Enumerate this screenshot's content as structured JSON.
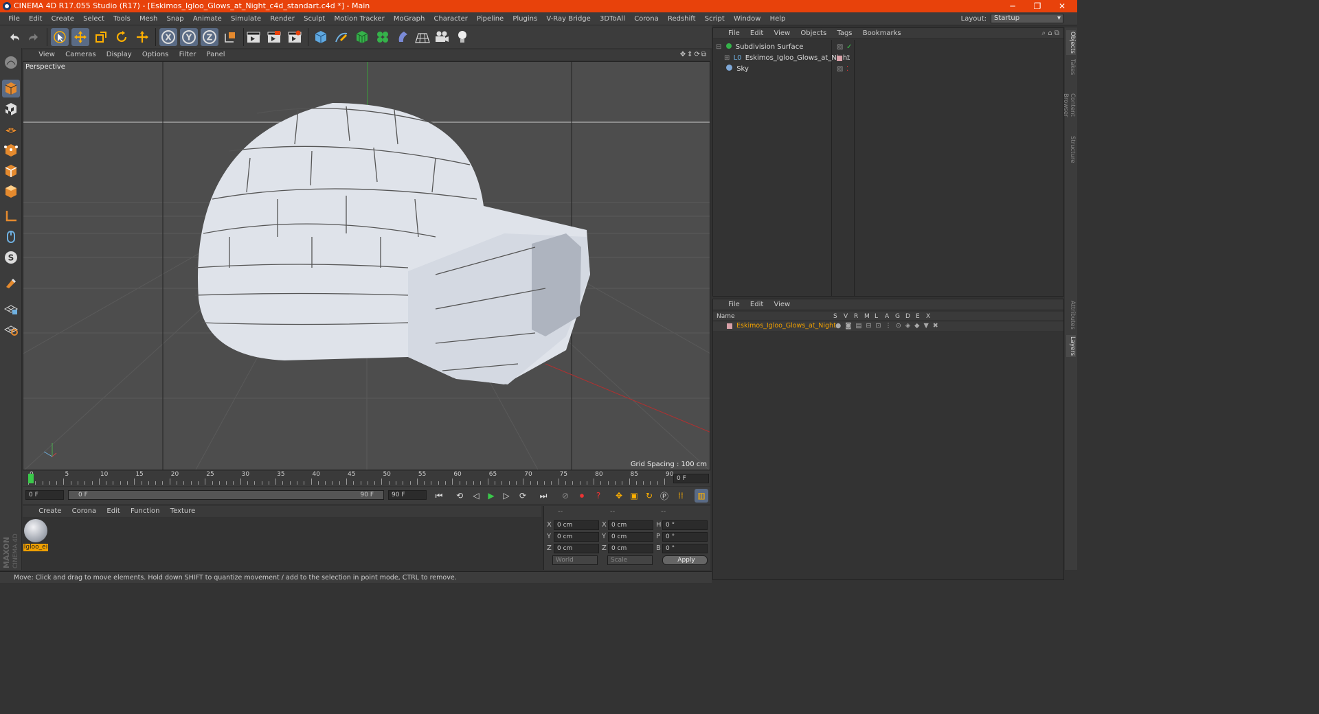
{
  "window": {
    "title": "CINEMA 4D R17.055 Studio (R17) - [Eskimos_Igloo_Glows_at_Night_c4d_standart.c4d *] - Main",
    "controls": [
      "─",
      "❐",
      "✕"
    ]
  },
  "menubar": {
    "items": [
      "File",
      "Edit",
      "Create",
      "Select",
      "Tools",
      "Mesh",
      "Snap",
      "Animate",
      "Simulate",
      "Render",
      "Sculpt",
      "Motion Tracker",
      "MoGraph",
      "Character",
      "Pipeline",
      "Plugins",
      "V-Ray Bridge",
      "3DToAll",
      "Corona",
      "Redshift",
      "Script",
      "Window",
      "Help"
    ],
    "layout_label": "Layout:",
    "layout_value": "Startup"
  },
  "viewport": {
    "menu": [
      "View",
      "Cameras",
      "Display",
      "Options",
      "Filter",
      "Panel"
    ],
    "camera_label": "Perspective",
    "grid_spacing": "Grid Spacing : 100 cm"
  },
  "timeline": {
    "ticks": [
      "0",
      "5",
      "10",
      "15",
      "20",
      "25",
      "30",
      "35",
      "40",
      "45",
      "50",
      "55",
      "60",
      "65",
      "70",
      "75",
      "80",
      "85",
      "90"
    ],
    "current_frame": "0 F"
  },
  "transport": {
    "start_field": "0 F",
    "range_start": "0 F",
    "range_end": "90 F",
    "end_field": "90 F"
  },
  "material_manager": {
    "menu": [
      "Create",
      "Corona",
      "Edit",
      "Function",
      "Texture"
    ],
    "material_name": "Igloo_ei"
  },
  "coordinates": {
    "headers": [
      "--",
      "--",
      "--"
    ],
    "rows": [
      {
        "a": "X",
        "av": "0 cm",
        "b": "X",
        "bv": "0 cm",
        "c": "H",
        "cv": "0 °"
      },
      {
        "a": "Y",
        "av": "0 cm",
        "b": "Y",
        "bv": "0 cm",
        "c": "P",
        "cv": "0 °"
      },
      {
        "a": "Z",
        "av": "0 cm",
        "b": "Z",
        "bv": "0 cm",
        "c": "B",
        "cv": "0 °"
      }
    ],
    "space": "World",
    "mode": "Scale",
    "apply": "Apply"
  },
  "status": "Move: Click and drag to move elements. Hold down SHIFT to quantize movement / add to the selection in point mode, CTRL to remove.",
  "object_manager": {
    "menu": [
      "File",
      "Edit",
      "View",
      "Objects",
      "Tags",
      "Bookmarks"
    ],
    "objects": [
      {
        "name": "Subdivision Surface",
        "color": "#35b24a"
      },
      {
        "name": "Eskimos_Igloo_Glows_at_Night",
        "color": "#6fb0e0"
      },
      {
        "name": "Sky",
        "color": "#7fa8d8"
      }
    ]
  },
  "layer_manager": {
    "menu": [
      "File",
      "Edit",
      "View"
    ],
    "columns": [
      "Name",
      "S",
      "V",
      "R",
      "M",
      "L",
      "A",
      "G",
      "D",
      "E",
      "X"
    ],
    "layer_name": "Eskimos_Igloo_Glows_at_Night",
    "layer_color": "#f0a000"
  },
  "side_tabs": [
    "Objects",
    "Takes",
    "Content Browser",
    "Structure",
    "Attributes",
    "Layers"
  ],
  "brand": "MAXON CINEMA 4D",
  "colors": {
    "accent": "#e8420b",
    "selection": "#5a6b85",
    "layer_highlight": "#f0a000"
  }
}
